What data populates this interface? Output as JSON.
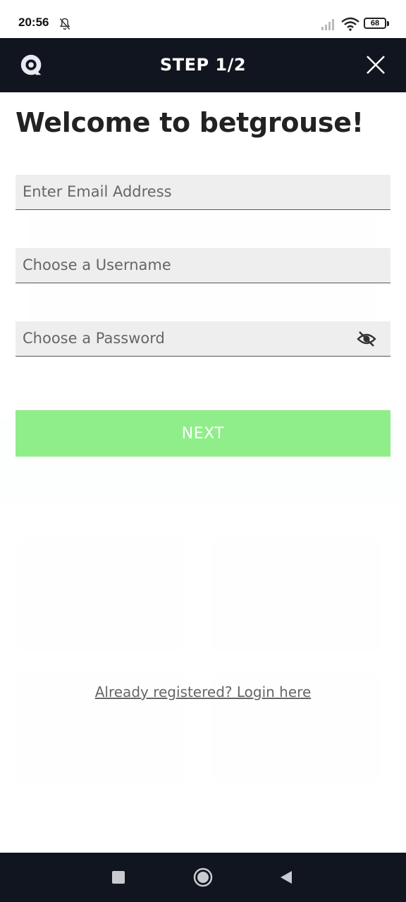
{
  "status_bar": {
    "time": "20:56",
    "battery": "68",
    "icons": [
      "bell-off-icon",
      "signal-icon",
      "wifi-icon",
      "battery-icon"
    ]
  },
  "modal": {
    "header_title": "STEP 1/2",
    "logo_icon": "betgrouse-logo-icon",
    "close_icon": "close-icon",
    "welcome": "Welcome to betgrouse!",
    "fields": {
      "email_placeholder": "Enter Email Address",
      "username_placeholder": "Choose a Username",
      "password_placeholder": "Choose a Password"
    },
    "next_label": "NEXT",
    "login_link": "Already registered? Login here"
  },
  "nav": {
    "icons": [
      "recent-apps-icon",
      "home-icon",
      "back-icon"
    ]
  },
  "colors": {
    "header_bg": "#11151f",
    "next_button": "#90ee8a",
    "field_bg": "#eeeeee"
  }
}
